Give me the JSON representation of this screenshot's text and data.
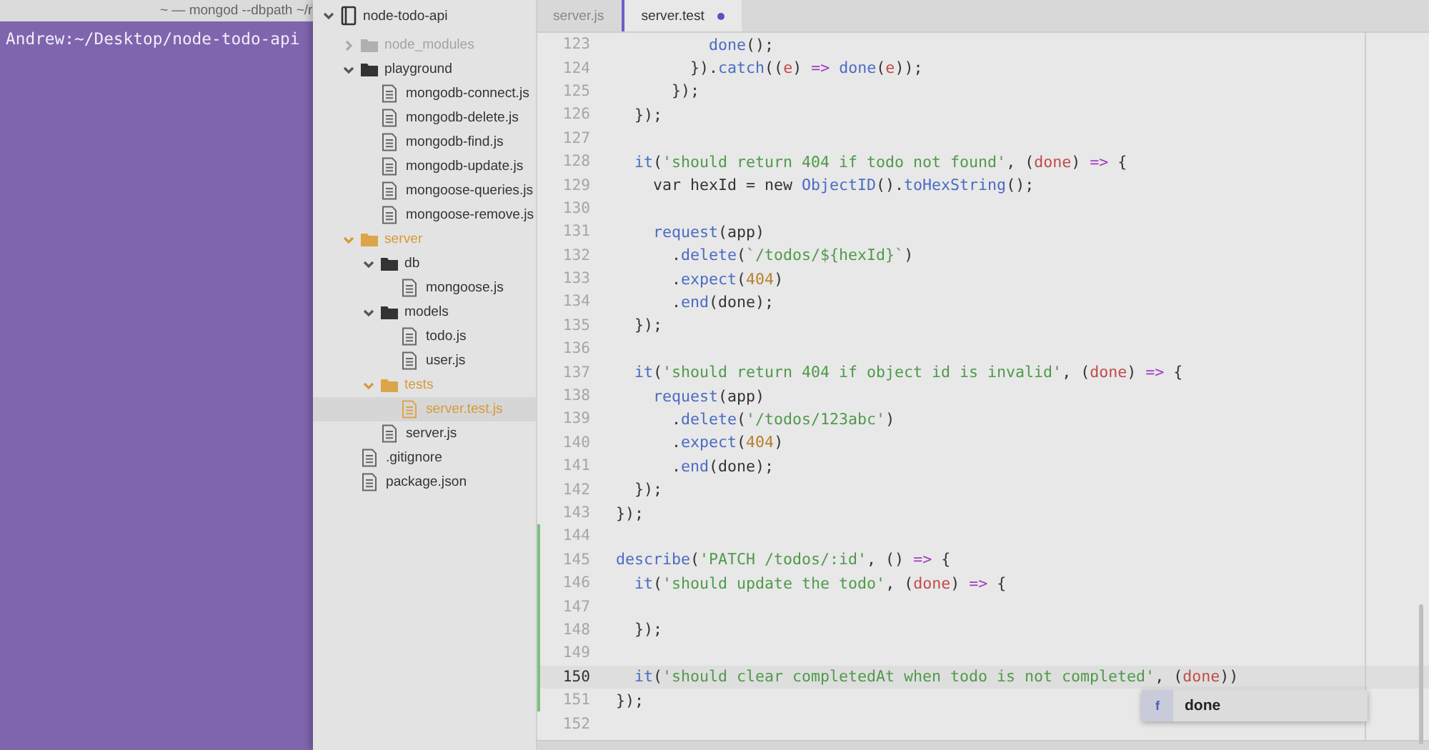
{
  "terminal": {
    "title": "~ — mongod --dbpath ~/r",
    "prompt": "Andrew:~/Desktop/node-todo-api"
  },
  "sidebar": {
    "tree": [
      {
        "label": "node-todo-api",
        "kind": "project",
        "expanded": true,
        "ignored": false,
        "modified": false,
        "selected": false,
        "children": [
          {
            "label": "node_modules",
            "kind": "folder",
            "expanded": false,
            "ignored": true,
            "modified": false,
            "selected": false
          },
          {
            "label": "playground",
            "kind": "folder",
            "expanded": true,
            "ignored": false,
            "modified": false,
            "selected": false,
            "children": [
              {
                "label": "mongodb-connect.js",
                "kind": "file",
                "ignored": false,
                "modified": false,
                "selected": false
              },
              {
                "label": "mongodb-delete.js",
                "kind": "file",
                "ignored": false,
                "modified": false,
                "selected": false
              },
              {
                "label": "mongodb-find.js",
                "kind": "file",
                "ignored": false,
                "modified": false,
                "selected": false
              },
              {
                "label": "mongodb-update.js",
                "kind": "file",
                "ignored": false,
                "modified": false,
                "selected": false
              },
              {
                "label": "mongoose-queries.js",
                "kind": "file",
                "ignored": false,
                "modified": false,
                "selected": false
              },
              {
                "label": "mongoose-remove.js",
                "kind": "file",
                "ignored": false,
                "modified": false,
                "selected": false
              }
            ]
          },
          {
            "label": "server",
            "kind": "folder",
            "expanded": true,
            "ignored": false,
            "modified": true,
            "selected": false,
            "children": [
              {
                "label": "db",
                "kind": "folder",
                "expanded": true,
                "ignored": false,
                "modified": false,
                "selected": false,
                "children": [
                  {
                    "label": "mongoose.js",
                    "kind": "file",
                    "ignored": false,
                    "modified": false,
                    "selected": false
                  }
                ]
              },
              {
                "label": "models",
                "kind": "folder",
                "expanded": true,
                "ignored": false,
                "modified": false,
                "selected": false,
                "children": [
                  {
                    "label": "todo.js",
                    "kind": "file",
                    "ignored": false,
                    "modified": false,
                    "selected": false
                  },
                  {
                    "label": "user.js",
                    "kind": "file",
                    "ignored": false,
                    "modified": false,
                    "selected": false
                  }
                ]
              },
              {
                "label": "tests",
                "kind": "folder",
                "expanded": true,
                "ignored": false,
                "modified": true,
                "selected": false,
                "children": [
                  {
                    "label": "server.test.js",
                    "kind": "file",
                    "ignored": false,
                    "modified": true,
                    "selected": true
                  }
                ]
              },
              {
                "label": "server.js",
                "kind": "file",
                "ignored": false,
                "modified": false,
                "selected": false
              }
            ]
          },
          {
            "label": ".gitignore",
            "kind": "file",
            "ignored": false,
            "modified": false,
            "selected": false
          },
          {
            "label": "package.json",
            "kind": "file",
            "ignored": false,
            "modified": false,
            "selected": false
          }
        ]
      }
    ]
  },
  "tabs": [
    {
      "label": "server.js",
      "selected": false,
      "modified": false
    },
    {
      "label": "server.test",
      "selected": true,
      "modified": true
    }
  ],
  "editor": {
    "lines": [
      {
        "number": "123",
        "changed": false,
        "current": false,
        "text": "          done();"
      },
      {
        "number": "124",
        "changed": false,
        "current": false,
        "text": "        }).catch((e) => done(e));"
      },
      {
        "number": "125",
        "changed": false,
        "current": false,
        "text": "      });"
      },
      {
        "number": "126",
        "changed": false,
        "current": false,
        "text": "  });"
      },
      {
        "number": "127",
        "changed": false,
        "current": false
      },
      {
        "number": "128",
        "changed": false,
        "current": false,
        "text": "  it('should return 404 if todo not found', (done) => {"
      },
      {
        "number": "129",
        "changed": false,
        "current": false,
        "text": "    var hexId = new ObjectID().toHexString();"
      },
      {
        "number": "130",
        "changed": false,
        "current": false
      },
      {
        "number": "131",
        "changed": false,
        "current": false,
        "text": "    request(app)"
      },
      {
        "number": "132",
        "changed": false,
        "current": false,
        "text": "      .delete(`/todos/${hexId}`)"
      },
      {
        "number": "133",
        "changed": false,
        "current": false,
        "text": "      .expect(404)"
      },
      {
        "number": "134",
        "changed": false,
        "current": false,
        "text": "      .end(done);"
      },
      {
        "number": "135",
        "changed": false,
        "current": false,
        "text": "  });"
      },
      {
        "number": "136",
        "changed": false,
        "current": false
      },
      {
        "number": "137",
        "changed": false,
        "current": false,
        "text": "  it('should return 404 if object id is invalid', (done) => {"
      },
      {
        "number": "138",
        "changed": false,
        "current": false,
        "text": "    request(app)"
      },
      {
        "number": "139",
        "changed": false,
        "current": false,
        "text": "      .delete('/todos/123abc')"
      },
      {
        "number": "140",
        "changed": false,
        "current": false,
        "text": "      .expect(404)"
      },
      {
        "number": "141",
        "changed": false,
        "current": false,
        "text": "      .end(done);"
      },
      {
        "number": "142",
        "changed": false,
        "current": false,
        "text": "  });"
      },
      {
        "number": "143",
        "changed": false,
        "current": false,
        "text": "});"
      },
      {
        "number": "144",
        "changed": true,
        "current": false
      },
      {
        "number": "145",
        "changed": true,
        "current": false,
        "text": "describe('PATCH /todos/:id', () => {"
      },
      {
        "number": "146",
        "changed": true,
        "current": false,
        "text": "  it('should update the todo', (done) => {"
      },
      {
        "number": "147",
        "changed": true,
        "current": false
      },
      {
        "number": "148",
        "changed": true,
        "current": false,
        "text": "  });"
      },
      {
        "number": "149",
        "changed": true,
        "current": false
      },
      {
        "number": "150",
        "changed": true,
        "current": true,
        "text": "  it('should clear completedAt when todo is not completed', (done))"
      },
      {
        "number": "151",
        "changed": true,
        "current": false,
        "text": "});"
      },
      {
        "number": "152",
        "changed": false,
        "current": false
      }
    ],
    "autocomplete": {
      "items": [
        {
          "badge": "f",
          "label": "done"
        }
      ]
    }
  }
}
